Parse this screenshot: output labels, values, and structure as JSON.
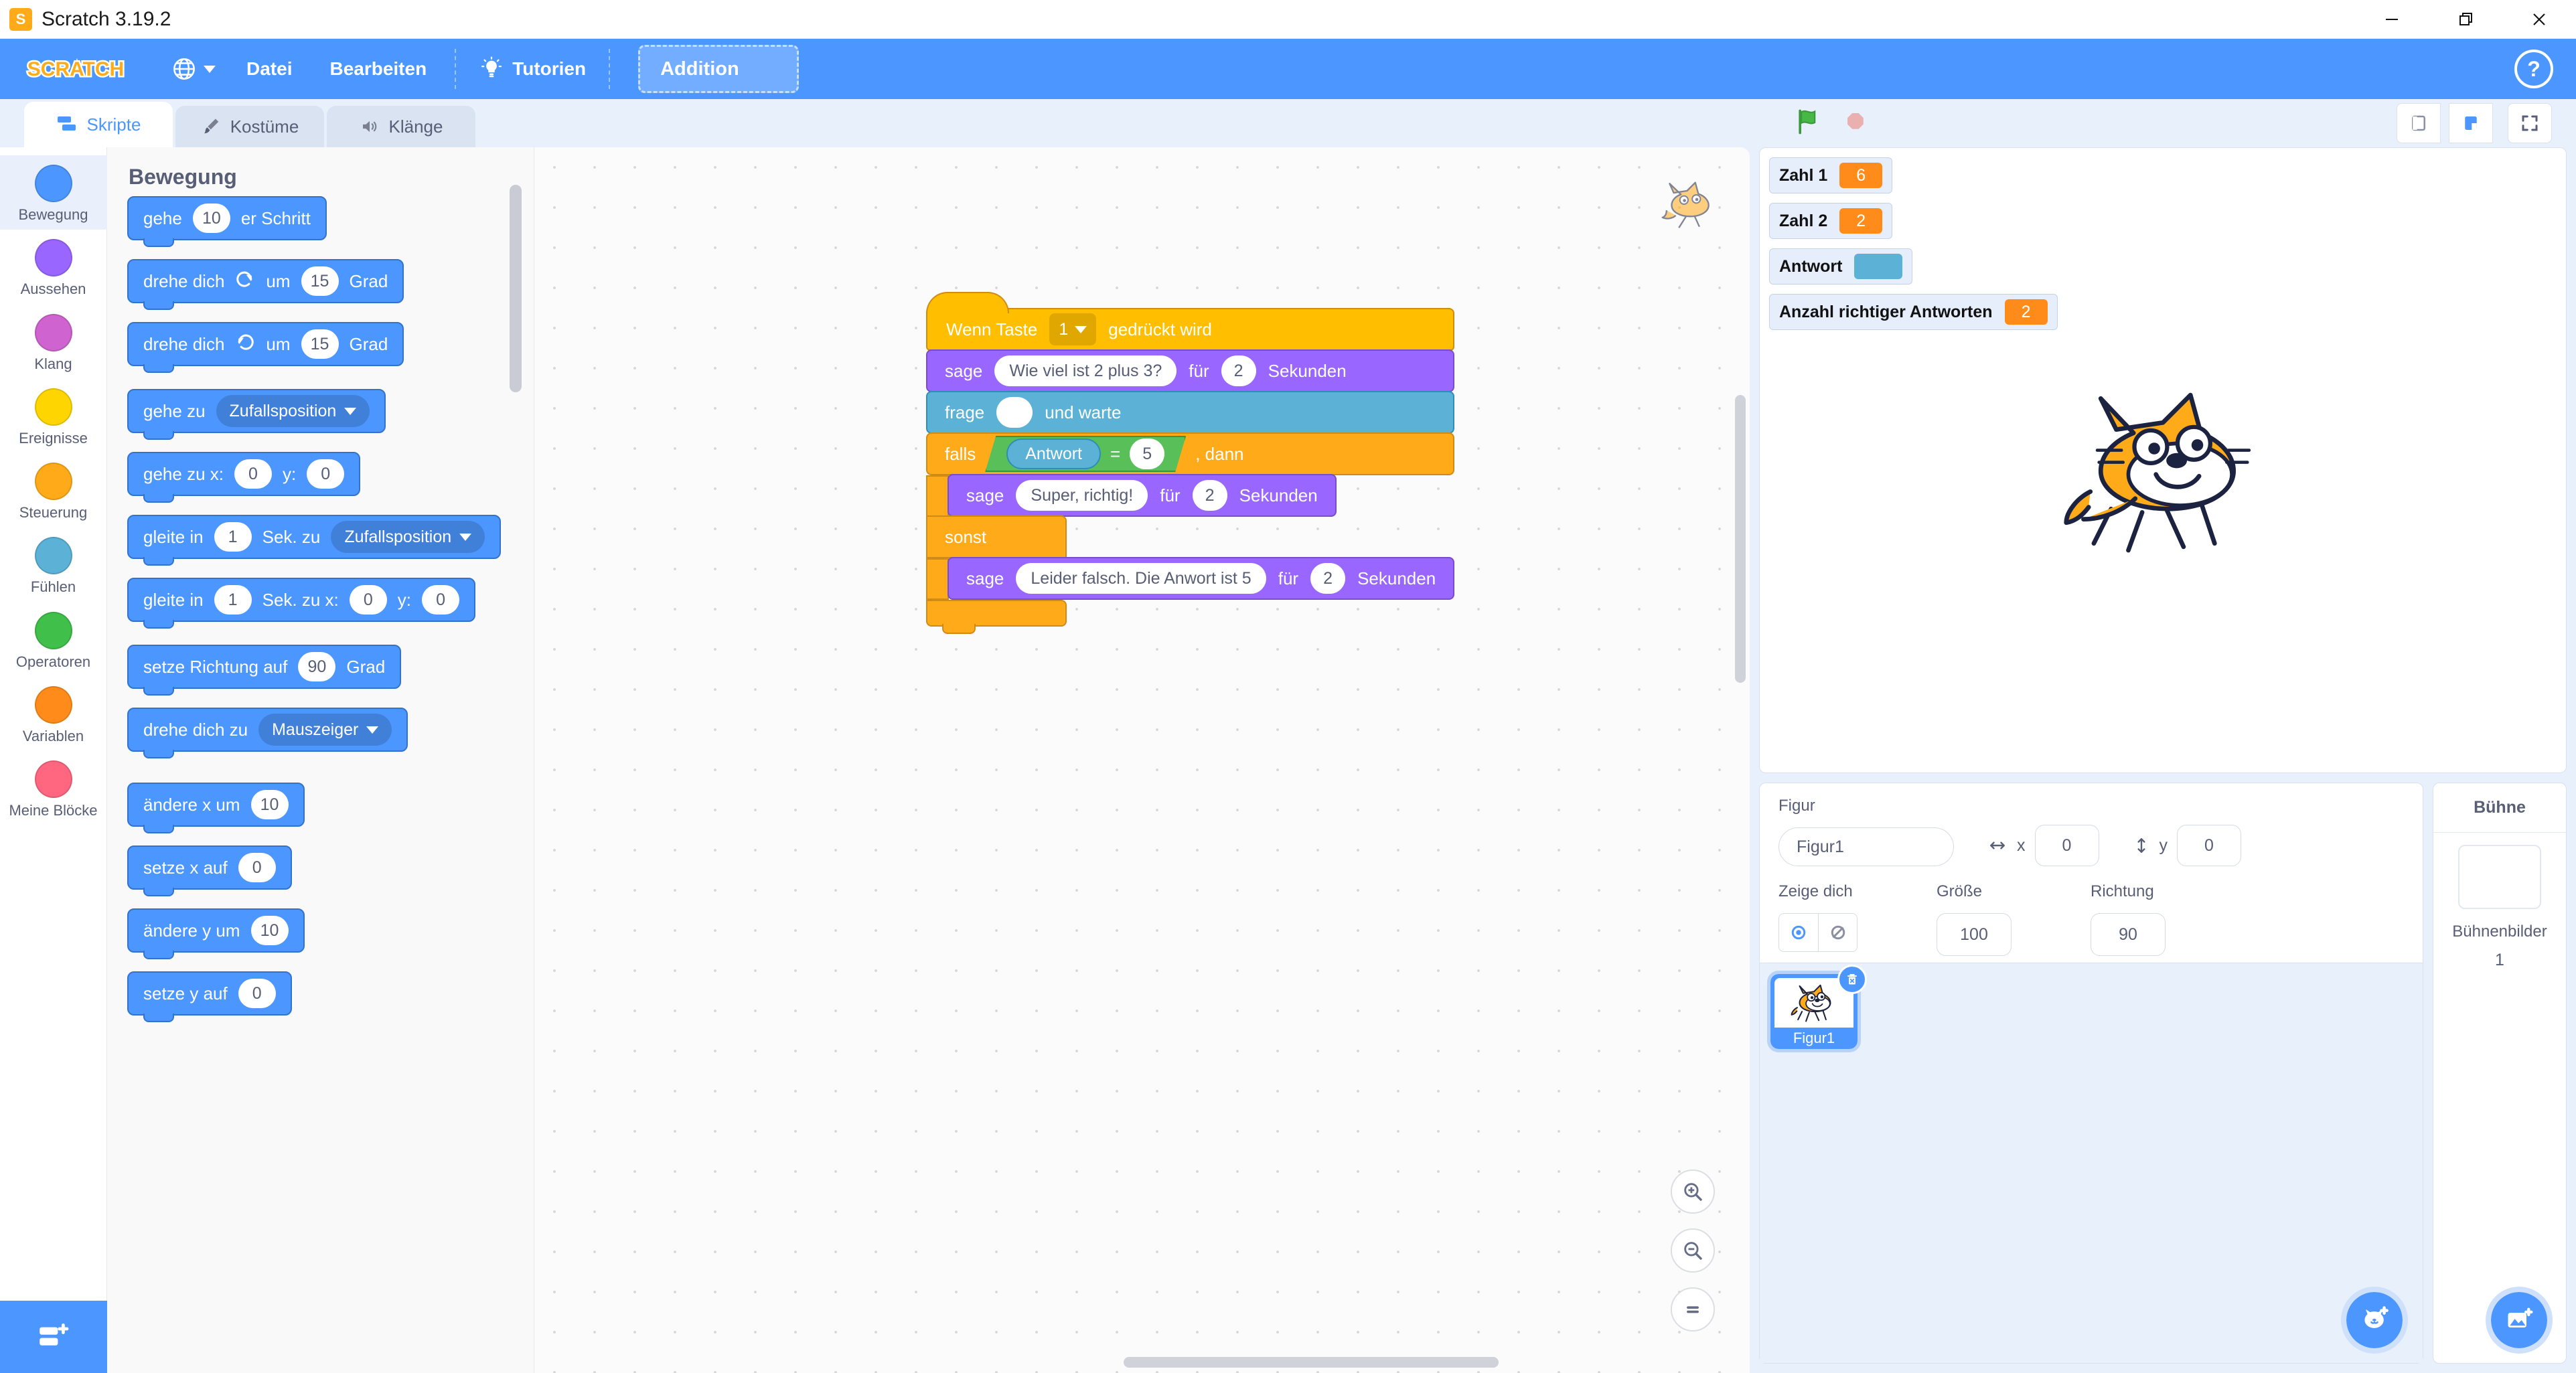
{
  "window": {
    "title": "Scratch 3.19.2",
    "logo_glyph": "S",
    "minimize": "—",
    "restore": "❐",
    "close": "✕"
  },
  "menubar": {
    "logo_text": "SCRATCH",
    "language_icon": "globe-icon",
    "file": "Datei",
    "edit": "Bearbeiten",
    "tutorials": "Tutorien",
    "project_name": "Addition",
    "help": "?"
  },
  "tabs": [
    {
      "label": "Skripte",
      "icon": "code-blocks-icon",
      "active": true
    },
    {
      "label": "Kostüme",
      "icon": "paintbrush-icon",
      "active": false
    },
    {
      "label": "Klänge",
      "icon": "speaker-icon",
      "active": false
    }
  ],
  "categories": [
    {
      "label": "Bewegung",
      "color": "#4c97ff",
      "selected": true
    },
    {
      "label": "Aussehen",
      "color": "#9966ff",
      "selected": false
    },
    {
      "label": "Klang",
      "color": "#cf63cf",
      "selected": false
    },
    {
      "label": "Ereignisse",
      "color": "#ffd500",
      "selected": false
    },
    {
      "label": "Steuerung",
      "color": "#ffab19",
      "selected": false
    },
    {
      "label": "Fühlen",
      "color": "#5cb1d6",
      "selected": false
    },
    {
      "label": "Operatoren",
      "color": "#40bf4a",
      "selected": false
    },
    {
      "label": "Variablen",
      "color": "#ff8c1a",
      "selected": false
    },
    {
      "label": "Meine Blöcke",
      "color": "#ff6680",
      "selected": false
    }
  ],
  "palette": {
    "heading": "Bewegung",
    "blocks": [
      {
        "parts": [
          {
            "t": "lbl",
            "v": "gehe"
          },
          {
            "t": "oval",
            "v": "10"
          },
          {
            "t": "lbl",
            "v": "er Schritt"
          }
        ]
      },
      {
        "parts": [
          {
            "t": "lbl",
            "v": "drehe dich"
          },
          {
            "t": "icon",
            "v": "turn-right-icon"
          },
          {
            "t": "lbl",
            "v": "um"
          },
          {
            "t": "oval",
            "v": "15"
          },
          {
            "t": "lbl",
            "v": "Grad"
          }
        ]
      },
      {
        "parts": [
          {
            "t": "lbl",
            "v": "drehe dich"
          },
          {
            "t": "icon",
            "v": "turn-left-icon"
          },
          {
            "t": "lbl",
            "v": "um"
          },
          {
            "t": "oval",
            "v": "15"
          },
          {
            "t": "lbl",
            "v": "Grad"
          }
        ]
      },
      {
        "parts": [
          {
            "t": "lbl",
            "v": "gehe zu"
          },
          {
            "t": "dd",
            "v": "Zufallsposition"
          }
        ]
      },
      {
        "parts": [
          {
            "t": "lbl",
            "v": "gehe zu x:"
          },
          {
            "t": "oval",
            "v": "0"
          },
          {
            "t": "lbl",
            "v": "y:"
          },
          {
            "t": "oval",
            "v": "0"
          }
        ]
      },
      {
        "parts": [
          {
            "t": "lbl",
            "v": "gleite in"
          },
          {
            "t": "oval",
            "v": "1"
          },
          {
            "t": "lbl",
            "v": "Sek. zu"
          },
          {
            "t": "dd",
            "v": "Zufallsposition"
          }
        ]
      },
      {
        "parts": [
          {
            "t": "lbl",
            "v": "gleite in"
          },
          {
            "t": "oval",
            "v": "1"
          },
          {
            "t": "lbl",
            "v": "Sek. zu x:"
          },
          {
            "t": "oval",
            "v": "0"
          },
          {
            "t": "lbl",
            "v": "y:"
          },
          {
            "t": "oval",
            "v": "0"
          }
        ]
      },
      {
        "parts": [
          {
            "t": "lbl",
            "v": "setze Richtung auf"
          },
          {
            "t": "oval",
            "v": "90"
          },
          {
            "t": "lbl",
            "v": "Grad"
          }
        ]
      },
      {
        "parts": [
          {
            "t": "lbl",
            "v": "drehe dich zu"
          },
          {
            "t": "dd",
            "v": "Mauszeiger"
          }
        ]
      },
      {
        "parts": [
          {
            "t": "lbl",
            "v": "ändere x um"
          },
          {
            "t": "oval",
            "v": "10"
          }
        ]
      },
      {
        "parts": [
          {
            "t": "lbl",
            "v": "setze x auf"
          },
          {
            "t": "oval",
            "v": "0"
          }
        ]
      },
      {
        "parts": [
          {
            "t": "lbl",
            "v": "ändere y um"
          },
          {
            "t": "oval",
            "v": "10"
          }
        ]
      },
      {
        "parts": [
          {
            "t": "lbl",
            "v": "setze y auf"
          },
          {
            "t": "oval",
            "v": "0"
          }
        ]
      }
    ]
  },
  "script": {
    "hat": {
      "pre": "Wenn Taste",
      "key": "1",
      "post": "gedrückt wird"
    },
    "say1": {
      "verb": "sage",
      "text": "Wie viel ist 2 plus 3?",
      "mid": "für",
      "secs": "2",
      "unit": "Sekunden"
    },
    "ask": {
      "verb": "frage",
      "text": "",
      "post": "und warte"
    },
    "if": {
      "kw": "falls",
      "reporter": "Antwort",
      "op": "=",
      "value": "5",
      "then": ", dann"
    },
    "say_true": {
      "verb": "sage",
      "text": "Super, richtig!",
      "mid": "für",
      "secs": "2",
      "unit": "Sekunden"
    },
    "else_kw": "sonst",
    "say_false": {
      "verb": "sage",
      "text": "Leider falsch. Die Anwort ist 5",
      "mid": "für",
      "secs": "2",
      "unit": "Sekunden"
    }
  },
  "zoom_controls": {
    "zoom_in": "zoom-in-icon",
    "zoom_out": "zoom-out-icon",
    "zoom_reset": "zoom-reset-icon"
  },
  "stage_controls": {
    "green_flag": "green-flag-icon",
    "stop": "stop-sign-icon",
    "small_stage": "small-stage-icon",
    "large_stage": "large-stage-icon",
    "fullscreen": "fullscreen-icon"
  },
  "monitors": [
    {
      "name": "Zahl 1",
      "value": "6",
      "empty": false
    },
    {
      "name": "Zahl 2",
      "value": "2",
      "empty": false
    },
    {
      "name": "Antwort",
      "value": "",
      "empty": true
    },
    {
      "name": "Anzahl richtiger Antworten",
      "value": "2",
      "empty": false
    }
  ],
  "sprite_info": {
    "figur_label": "Figur",
    "name_value": "Figur1",
    "x_label": "x",
    "x_value": "0",
    "y_label": "y",
    "y_value": "0",
    "show_label": "Zeige dich",
    "size_label": "Größe",
    "size_value": "100",
    "direction_label": "Richtung",
    "direction_value": "90",
    "show_icon": "eye-visible-icon",
    "hide_icon": "eye-hidden-icon"
  },
  "sprite_list": [
    {
      "name": "Figur1",
      "selected": true,
      "delete_icon": "trash-icon"
    }
  ],
  "add_sprite_fab": "add-sprite-cat-icon",
  "add_backdrop_fab": "add-backdrop-icon",
  "stage_panel": {
    "title": "Bühne",
    "backdrops_label": "Bühnenbilder",
    "backdrops_count": "1"
  }
}
